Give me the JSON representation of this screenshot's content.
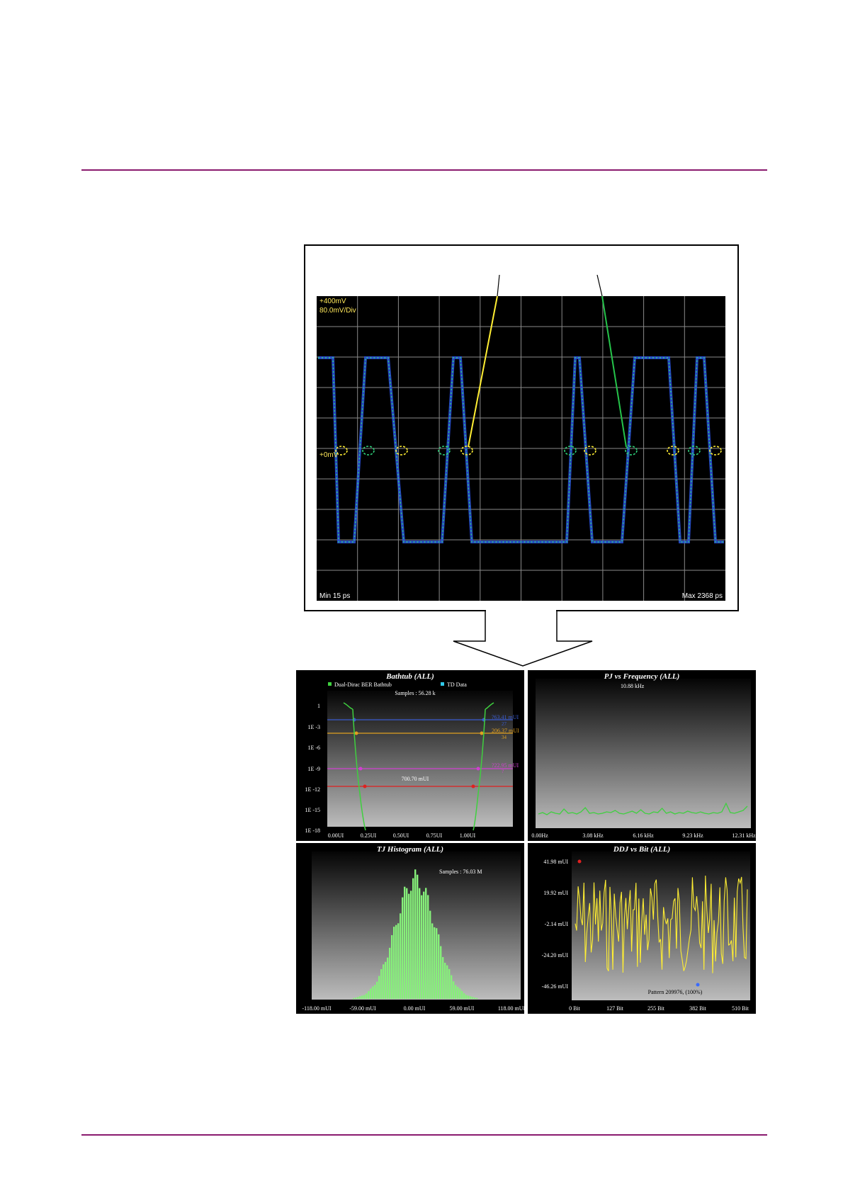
{
  "scope": {
    "top_label": "+400mV",
    "scale_label": "80.0mV/Div",
    "zero_label": "+0mV",
    "min_label": "Min 15 ps",
    "max_label": "Max 2368 ps"
  },
  "bathtub": {
    "title": "Bathtub (ALL)",
    "legend": [
      "Dual-Dirac BER Bathtub",
      "TD Data"
    ],
    "samples": "Samples : 56.28 k",
    "y_ticks": [
      "1",
      "1E -3",
      "1E -6",
      "1E -9",
      "1E -12",
      "1E -15",
      "1E -18"
    ],
    "x_ticks": [
      "0.00UI",
      "0.25UI",
      "0.50UI",
      "0.75UI",
      "1.00UI"
    ],
    "annotations": [
      "?63.41 mUI",
      "27",
      "206.37 mUI",
      "34",
      "?22.95 mUI",
      "?",
      "700.70 mUI"
    ],
    "colors": {
      "blue": "#3a5bd0",
      "orange": "#e0a020",
      "magenta": "#d040d0",
      "red": "#e02020",
      "curve": "#3fd03f"
    }
  },
  "pj": {
    "title": "PJ vs Frequency (ALL)",
    "peak_label": "10.88 kHz",
    "x_ticks": [
      "0.00Hz",
      "3.08 kHz",
      "6.16 kHz",
      "9.23 kHz",
      "12.31 kHz"
    ]
  },
  "tj": {
    "title": "TJ Histogram (ALL)",
    "samples": "Samples : 76.03 M",
    "x_ticks": [
      "-118.00 mUI",
      "-59.00 mUI",
      "0.00 mUI",
      "59.00 mUI",
      "118.00 mUI"
    ]
  },
  "ddj": {
    "title": "DDJ vs Bit (ALL)",
    "y_ticks": [
      "41.98 mUI",
      "19.92 mUI",
      "-2.14 mUI",
      "-24.20 mUI",
      "-46.26 mUI"
    ],
    "x_ticks": [
      "0 Bit",
      "127 Bit",
      "255 Bit",
      "382 Bit",
      "510 Bit"
    ],
    "pattern_label": "Pattern 209976, (100%)"
  }
}
